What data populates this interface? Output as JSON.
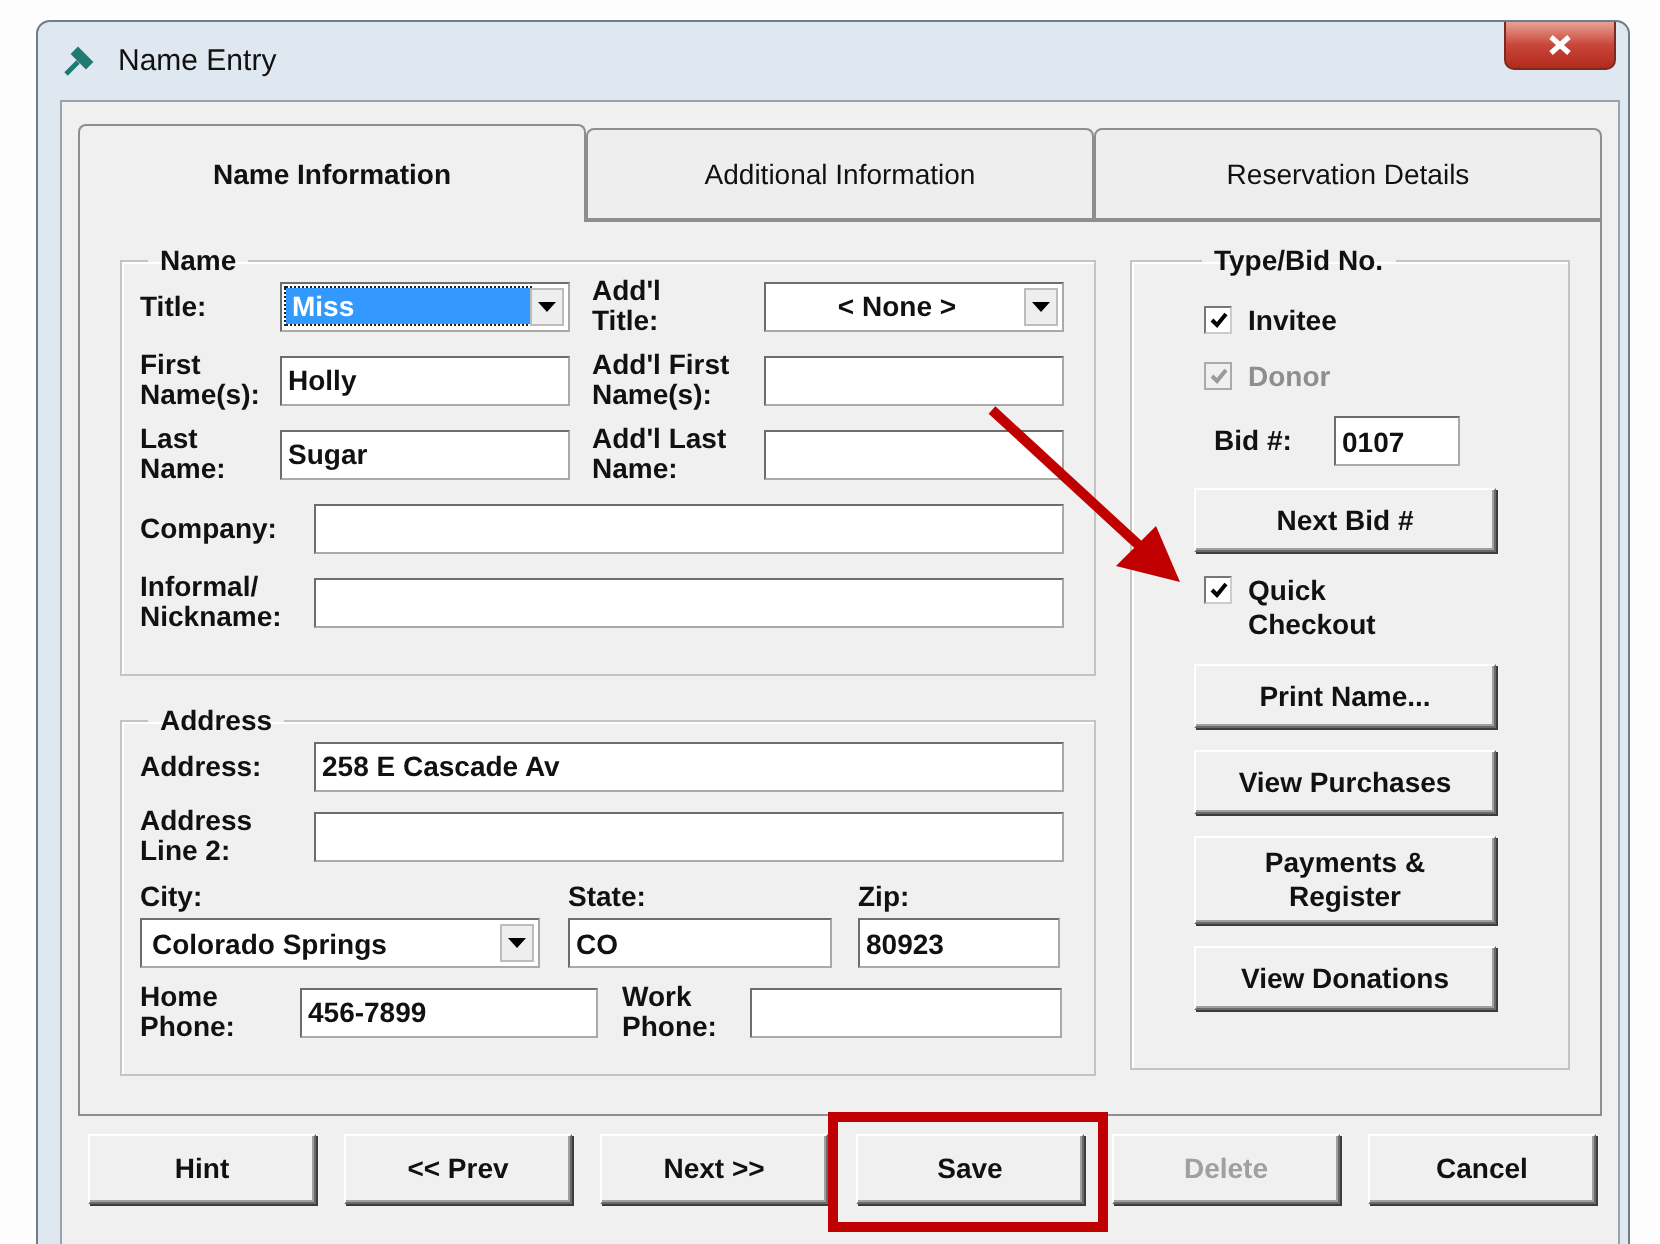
{
  "window": {
    "title": "Name Entry"
  },
  "tabs": [
    {
      "label": "Name Information",
      "selected": true
    },
    {
      "label": "Additional Information",
      "selected": false
    },
    {
      "label": "Reservation Details",
      "selected": false
    }
  ],
  "name_group": {
    "title": "Name",
    "title_field": {
      "label": "Title:",
      "value": "Miss",
      "focused": true
    },
    "addl_title": {
      "label": "Add'l\nTitle:",
      "value": "< None >",
      "focused": false
    },
    "first_name": {
      "label": "First\nName(s):",
      "value": "Holly"
    },
    "addl_first_name": {
      "label": "Add'l First\nName(s):"
    },
    "last_name": {
      "label": "Last\nName:",
      "value": "Sugar"
    },
    "addl_last_name": {
      "label": "Add'l Last\nName:"
    },
    "company": {
      "label": "Company:"
    },
    "nickname": {
      "label": "Informal/\nNickname:"
    }
  },
  "address_group": {
    "title": "Address",
    "address": {
      "label": "Address:",
      "value": "258 E Cascade Av"
    },
    "address_line_2": {
      "label": "Address\nLine 2:"
    },
    "city": {
      "label": "City:",
      "value": "Colorado Springs"
    },
    "state": {
      "label": "State:",
      "value": "CO"
    },
    "zip": {
      "label": "Zip:",
      "value": "80923"
    },
    "home_phone": {
      "label": "Home\nPhone:",
      "value": "456-7899"
    },
    "work_phone": {
      "label": "Work\nPhone:"
    }
  },
  "type_group": {
    "title": "Type/Bid No.",
    "items": [
      {
        "kind": "checkbox",
        "label": "Invitee",
        "checked": true,
        "disabled": false
      },
      {
        "kind": "checkbox",
        "label": "Donor",
        "checked": true,
        "disabled": true
      },
      {
        "kind": "field",
        "label": "Bid #:",
        "value": "0107"
      },
      {
        "kind": "button",
        "label": "Next Bid #"
      },
      {
        "kind": "checkbox",
        "label": "Quick\nCheckout",
        "checked": true,
        "disabled": false
      },
      {
        "kind": "button",
        "label": "Print Name..."
      },
      {
        "kind": "button",
        "label": "View Purchases"
      },
      {
        "kind": "button",
        "label": "Payments &\nRegister"
      },
      {
        "kind": "button",
        "label": "View Donations"
      }
    ]
  },
  "buttons": [
    {
      "label": "Hint",
      "disabled": false,
      "highlighted": false
    },
    {
      "label": "<< Prev",
      "disabled": false,
      "highlighted": false
    },
    {
      "label": "Next >>",
      "disabled": false,
      "highlighted": false
    },
    {
      "label": "Save",
      "disabled": false,
      "highlighted": true
    },
    {
      "label": "Delete",
      "disabled": true,
      "highlighted": false
    },
    {
      "label": "Cancel",
      "disabled": false,
      "highlighted": false
    }
  ]
}
